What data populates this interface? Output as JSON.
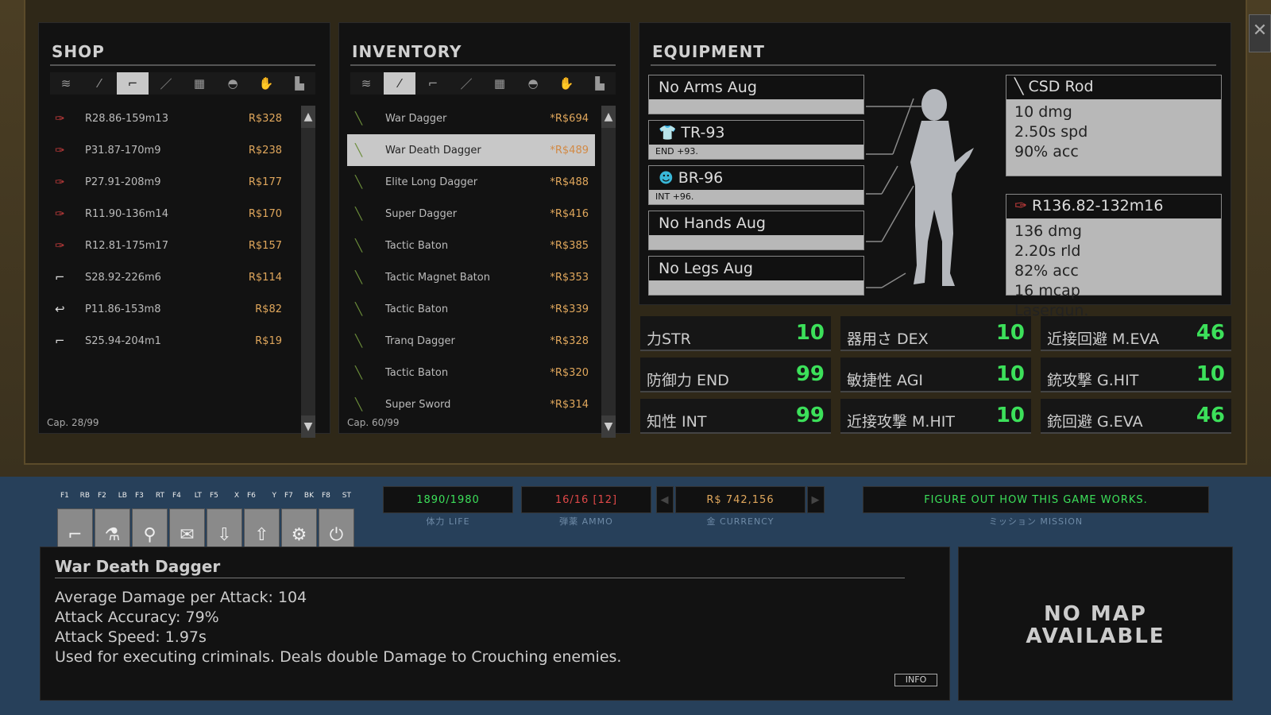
{
  "shop": {
    "title": "SHOP",
    "capacity": "Cap. 28/99",
    "tabs": [
      "layers-icon",
      "dagger-icon",
      "pistol-icon",
      "knife-icon",
      "armor-icon",
      "helmet-icon",
      "glove-icon",
      "boot-icon"
    ],
    "items": [
      {
        "icon": "gun-icon",
        "name": "R28.86-159m13",
        "price": "R$328"
      },
      {
        "icon": "gun-icon",
        "name": "P31.87-170m9",
        "price": "R$238"
      },
      {
        "icon": "gun-icon",
        "name": "P27.91-208m9",
        "price": "R$177"
      },
      {
        "icon": "gun-icon",
        "name": "R11.90-136m14",
        "price": "R$170"
      },
      {
        "icon": "gun-icon",
        "name": "R12.81-175m17",
        "price": "R$157"
      },
      {
        "icon": "rifle-icon",
        "name": "S28.92-226m6",
        "price": "R$114"
      },
      {
        "icon": "pistol-icon",
        "name": "P11.86-153m8",
        "price": "R$82"
      },
      {
        "icon": "rifle-icon",
        "name": "S25.94-204m1",
        "price": "R$19"
      }
    ]
  },
  "inventory": {
    "title": "INVENTORY",
    "capacity": "Cap. 60/99",
    "items": [
      {
        "name": "War Dagger",
        "price": "*R$694"
      },
      {
        "name": "War Death Dagger",
        "price": "*R$489"
      },
      {
        "name": "Elite Long Dagger",
        "price": "*R$488"
      },
      {
        "name": "Super Dagger",
        "price": "*R$416"
      },
      {
        "name": "Tactic Baton",
        "price": "*R$385"
      },
      {
        "name": "Tactic Magnet Baton",
        "price": "*R$353"
      },
      {
        "name": "Tactic Baton",
        "price": "*R$339"
      },
      {
        "name": "Tranq Dagger",
        "price": "*R$328"
      },
      {
        "name": "Tactic Baton",
        "price": "*R$320"
      },
      {
        "name": "Super Sword",
        "price": "*R$314"
      }
    ]
  },
  "equipment": {
    "title": "EQUIPMENT",
    "slots": [
      {
        "name": "No Arms Aug",
        "detail": ""
      },
      {
        "name": "TR-93",
        "detail": "END +93."
      },
      {
        "name": "BR-96",
        "detail": "INT +96."
      },
      {
        "name": "No Hands Aug",
        "detail": ""
      },
      {
        "name": "No Legs Aug",
        "detail": ""
      }
    ],
    "melee": {
      "name": "CSD Rod",
      "dmg": "10 dmg",
      "spd": "2.50s spd",
      "acc": "90% acc"
    },
    "ranged": {
      "name": "R136.82-132m16",
      "dmg": "136 dmg",
      "rld": "2.20s rld",
      "acc": "82% acc",
      "mcap": "16 mcap",
      "type": "Lasergun."
    }
  },
  "stats": [
    {
      "label": "力STR",
      "value": "10"
    },
    {
      "label": "器用さ DEX",
      "value": "10"
    },
    {
      "label": "近接回避 M.EVA",
      "value": "46"
    },
    {
      "label": "防御力 END",
      "value": "99"
    },
    {
      "label": "敏捷性 AGI",
      "value": "10"
    },
    {
      "label": "銃攻撃 G.HIT",
      "value": "10"
    },
    {
      "label": "知性 INT",
      "value": "99"
    },
    {
      "label": "近接攻撃 M.HIT",
      "value": "10"
    },
    {
      "label": "銃回避 G.EVA",
      "value": "46"
    }
  ],
  "hud": {
    "life": "1890/1980",
    "life_label": "体力 LIFE",
    "ammo": "16/16 [12]",
    "ammo_label": "弾薬 AMMO",
    "currency": "R$ 742,156",
    "currency_label": "金 CURRENCY",
    "mission": "FIGURE OUT HOW THIS GAME WORKS.",
    "mission_label": "ミッション MISSION",
    "fkeys": [
      {
        "k": "F1",
        "b": "RB"
      },
      {
        "k": "F2",
        "b": "LB"
      },
      {
        "k": "F3",
        "b": "RT"
      },
      {
        "k": "F4",
        "b": "LT"
      },
      {
        "k": "F5",
        "b": "X"
      },
      {
        "k": "F6",
        "b": "Y"
      },
      {
        "k": "F7",
        "b": "BK"
      },
      {
        "k": "F8",
        "b": "ST"
      }
    ]
  },
  "info": {
    "title": "War Death Dagger",
    "lines": [
      "Average Damage per Attack: 104",
      "Attack Accuracy: 79%",
      "Attack Speed: 1.97s",
      "Used for executing criminals. Deals double Damage to Crouching enemies."
    ],
    "button": "INFO"
  },
  "map": {
    "line1": "NO MAP",
    "line2": "AVAILABLE"
  },
  "colors": {
    "green": "#3ce05a",
    "price": "#e0a75c",
    "hud_bg": "#27405a"
  }
}
